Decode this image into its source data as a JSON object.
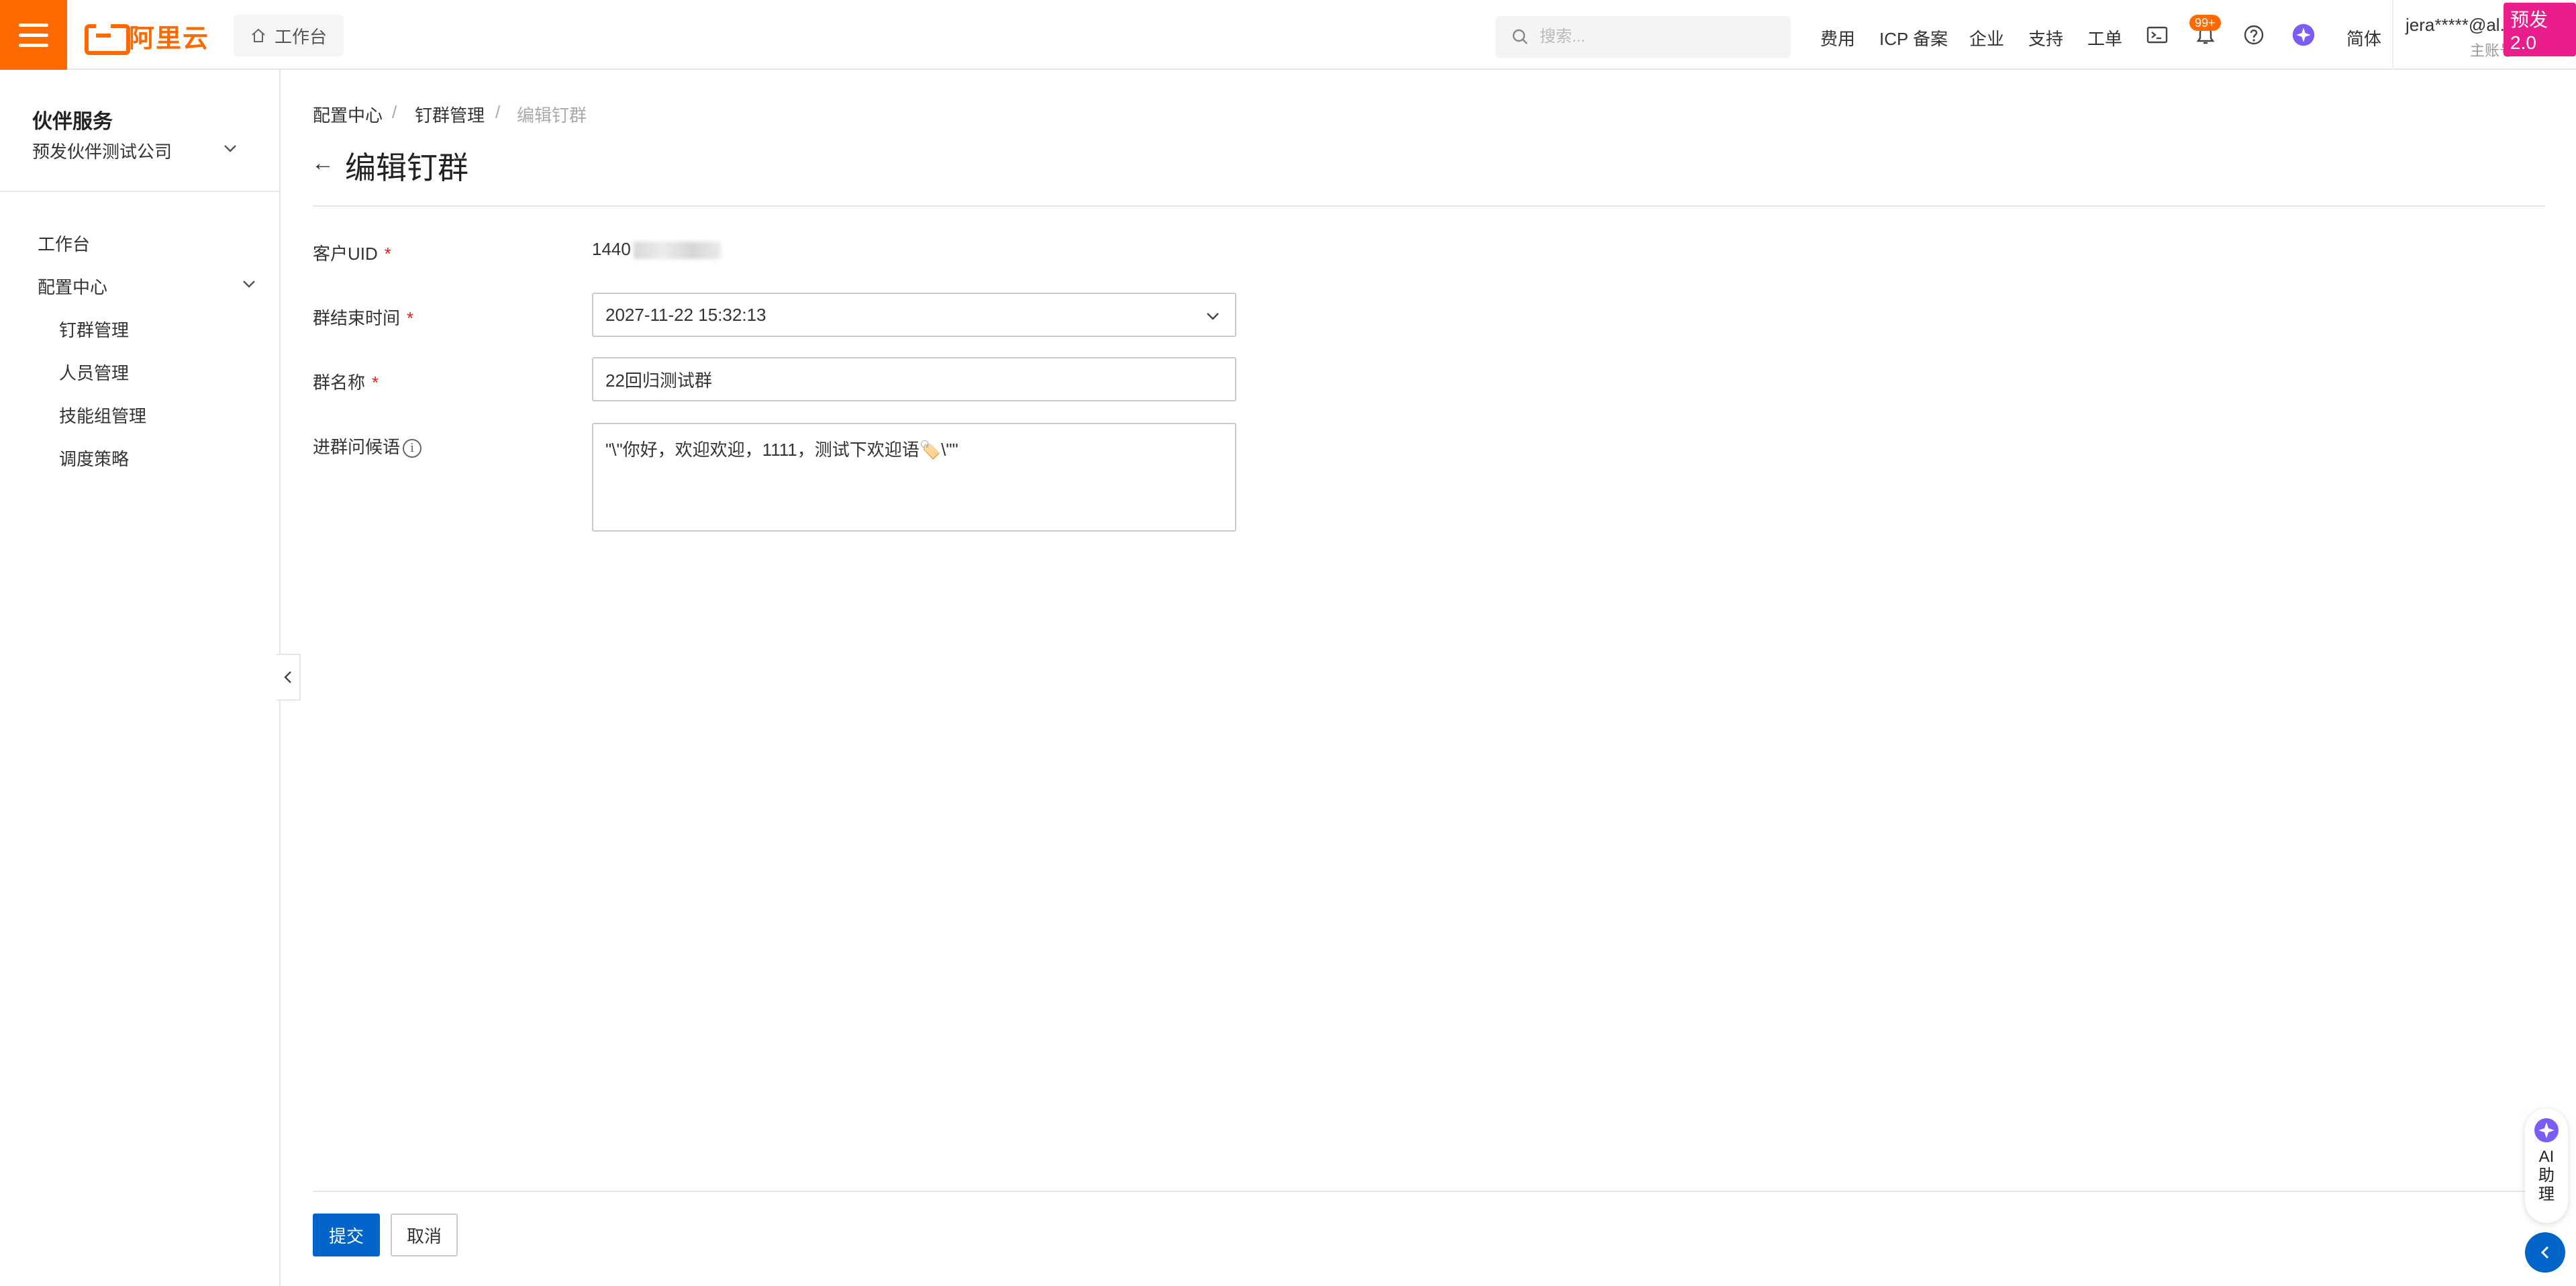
{
  "topbar": {
    "logo_text": "阿里云",
    "workbench": "工作台",
    "search_placeholder": "搜索...",
    "nav": [
      "费用",
      "ICP 备案",
      "企业",
      "支持",
      "工单"
    ],
    "notifications_badge": "99+",
    "language": "简体",
    "user_name": "jera*****@al...",
    "user_role": "主账号",
    "env_tag": "预发2.0"
  },
  "sidebar": {
    "title": "伙伴服务",
    "org": "预发伙伴测试公司",
    "items": {
      "workbench": "工作台",
      "config_center": "配置中心",
      "ding_group": "钉群管理",
      "staff": "人员管理",
      "skill_group": "技能组管理",
      "dispatch": "调度策略"
    }
  },
  "breadcrumb": [
    "配置中心",
    "钉群管理",
    "编辑钉群"
  ],
  "page_title": "编辑钉群",
  "form": {
    "uid_label": "客户UID",
    "uid_value": "1440",
    "end_time_label": "群结束时间",
    "end_time_value": "2027-11-22 15:32:13",
    "name_label": "群名称",
    "name_value": "22回归测试群",
    "greeting_label": "进群问候语",
    "greeting_value": "\"\\\"你好，欢迎欢迎，1111，测试下欢迎语🏷️\\\"\"",
    "required_mark": "*"
  },
  "actions": {
    "submit": "提交",
    "cancel": "取消"
  },
  "ai_assistant": {
    "label": "AI助理"
  },
  "colors": {
    "brand": "#ff6a00",
    "primary": "#0064c8",
    "env_tag": "#e91e8c",
    "required": "#e02020"
  }
}
